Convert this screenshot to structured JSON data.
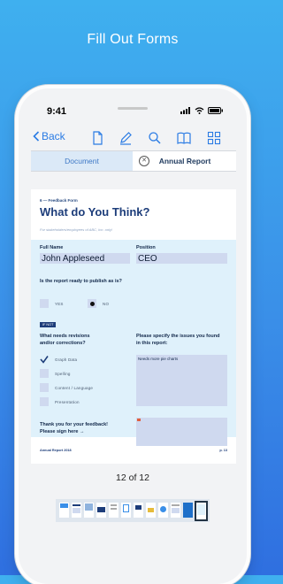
{
  "headline": "Fill Out Forms",
  "status": {
    "time": "9:41"
  },
  "toolbar": {
    "back_label": "Back"
  },
  "tabs": [
    {
      "label": "Document",
      "active": true
    },
    {
      "label": "Annual Report",
      "active": false
    }
  ],
  "document": {
    "eyebrow": "6 — Feedback Form",
    "title": "What do You Think?",
    "subtitle": "For stakeholders/employees of ABC, Inc. only!",
    "form": {
      "full_name_label": "Full Name",
      "full_name_value": "John Appleseed",
      "position_label": "Position",
      "position_value": "CEO",
      "publish_question": "Is the report ready to publish as is?",
      "yes_label": "YES",
      "no_label": "NO",
      "publish_answer": "NO",
      "if_not_badge": "IF NOT",
      "revisions_question_1": "What needs revisions",
      "revisions_question_2": "and/or corrections?",
      "revision_options": [
        {
          "label": "Graph Data",
          "checked": true
        },
        {
          "label": "Spelling",
          "checked": false
        },
        {
          "label": "Content / Language",
          "checked": false
        },
        {
          "label": "Presentation",
          "checked": false
        }
      ],
      "issues_question_1": "Please specify the issues you found",
      "issues_question_2": "in this report:",
      "issues_value": "Needs more pie charts",
      "thanks_1": "Thank you for your feedback!",
      "thanks_2": "Please sign here →"
    },
    "footer_left": "Annual Report 2018",
    "footer_right": "p. 13"
  },
  "pager": {
    "label": "12 of 12",
    "current": 12,
    "total": 12
  },
  "colors": {
    "accent": "#2a7be4",
    "brand_navy": "#1d3d7a",
    "form_bg": "#dff1fb",
    "field_bg": "#cfd9ef"
  }
}
